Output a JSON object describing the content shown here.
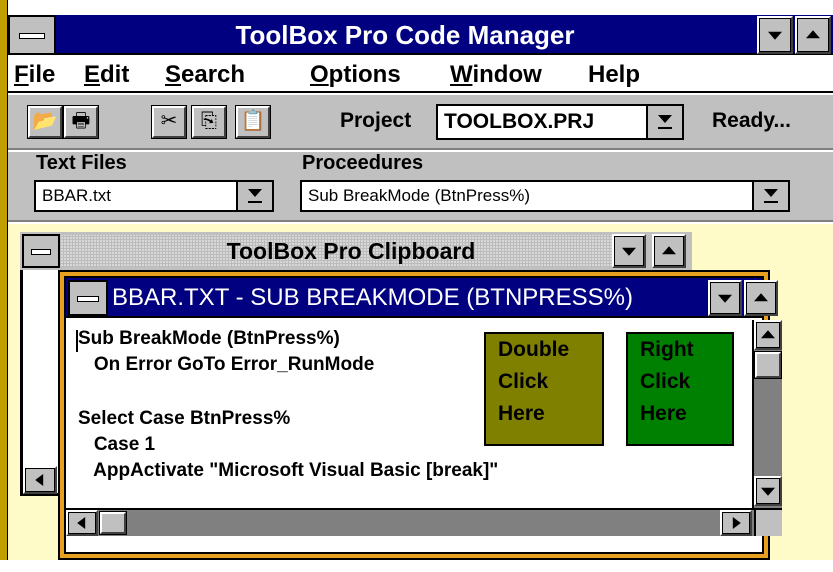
{
  "colors": {
    "titlebar_active": "#000080",
    "mdi_background": "#fffbc8",
    "frame_accent": "#c0a000",
    "editor_frame": "#e8a020",
    "double_click_box": "#808000",
    "right_click_box": "#008000"
  },
  "app": {
    "title": "ToolBox Pro Code Manager"
  },
  "menubar": {
    "items": [
      {
        "label": "File",
        "mnemonic": "F"
      },
      {
        "label": "Edit",
        "mnemonic": "E"
      },
      {
        "label": "Search",
        "mnemonic": "S"
      },
      {
        "label": "Options",
        "mnemonic": "O"
      },
      {
        "label": "Window",
        "mnemonic": "W"
      },
      {
        "label": "Help",
        "mnemonic": ""
      }
    ]
  },
  "toolbar": {
    "buttons": [
      {
        "name": "open-folder-icon",
        "glyph": "📂"
      },
      {
        "name": "printer-icon",
        "glyph": "🖶"
      },
      {
        "name": "cut-icon",
        "glyph": "✂"
      },
      {
        "name": "copy-icon",
        "glyph": "⎘"
      },
      {
        "name": "paste-icon",
        "glyph": "📋"
      }
    ],
    "project_label": "Project",
    "project_value": "TOOLBOX.PRJ",
    "status": "Ready..."
  },
  "selectors": {
    "text_files_label": "Text Files",
    "text_files_value": "BBAR.txt",
    "procedures_label": "Proceedures",
    "procedures_value": "Sub BreakMode (BtnPress%)"
  },
  "clipboard_window": {
    "title": "ToolBox Pro Clipboard"
  },
  "editor_window": {
    "title": "BBAR.TXT - SUB BREAKMODE (BTNPRESS%)",
    "code_lines": [
      "Sub BreakMode (BtnPress%)",
      "   On Error GoTo Error_RunMode",
      "",
      "Select Case BtnPress%",
      "   Case 1",
      "   AppActivate \"Microsoft Visual Basic [break]\""
    ],
    "double_click_box": {
      "lines": [
        "Double",
        "Click",
        "Here"
      ]
    },
    "right_click_box": {
      "lines": [
        "Right",
        "Click",
        "Here"
      ]
    }
  }
}
